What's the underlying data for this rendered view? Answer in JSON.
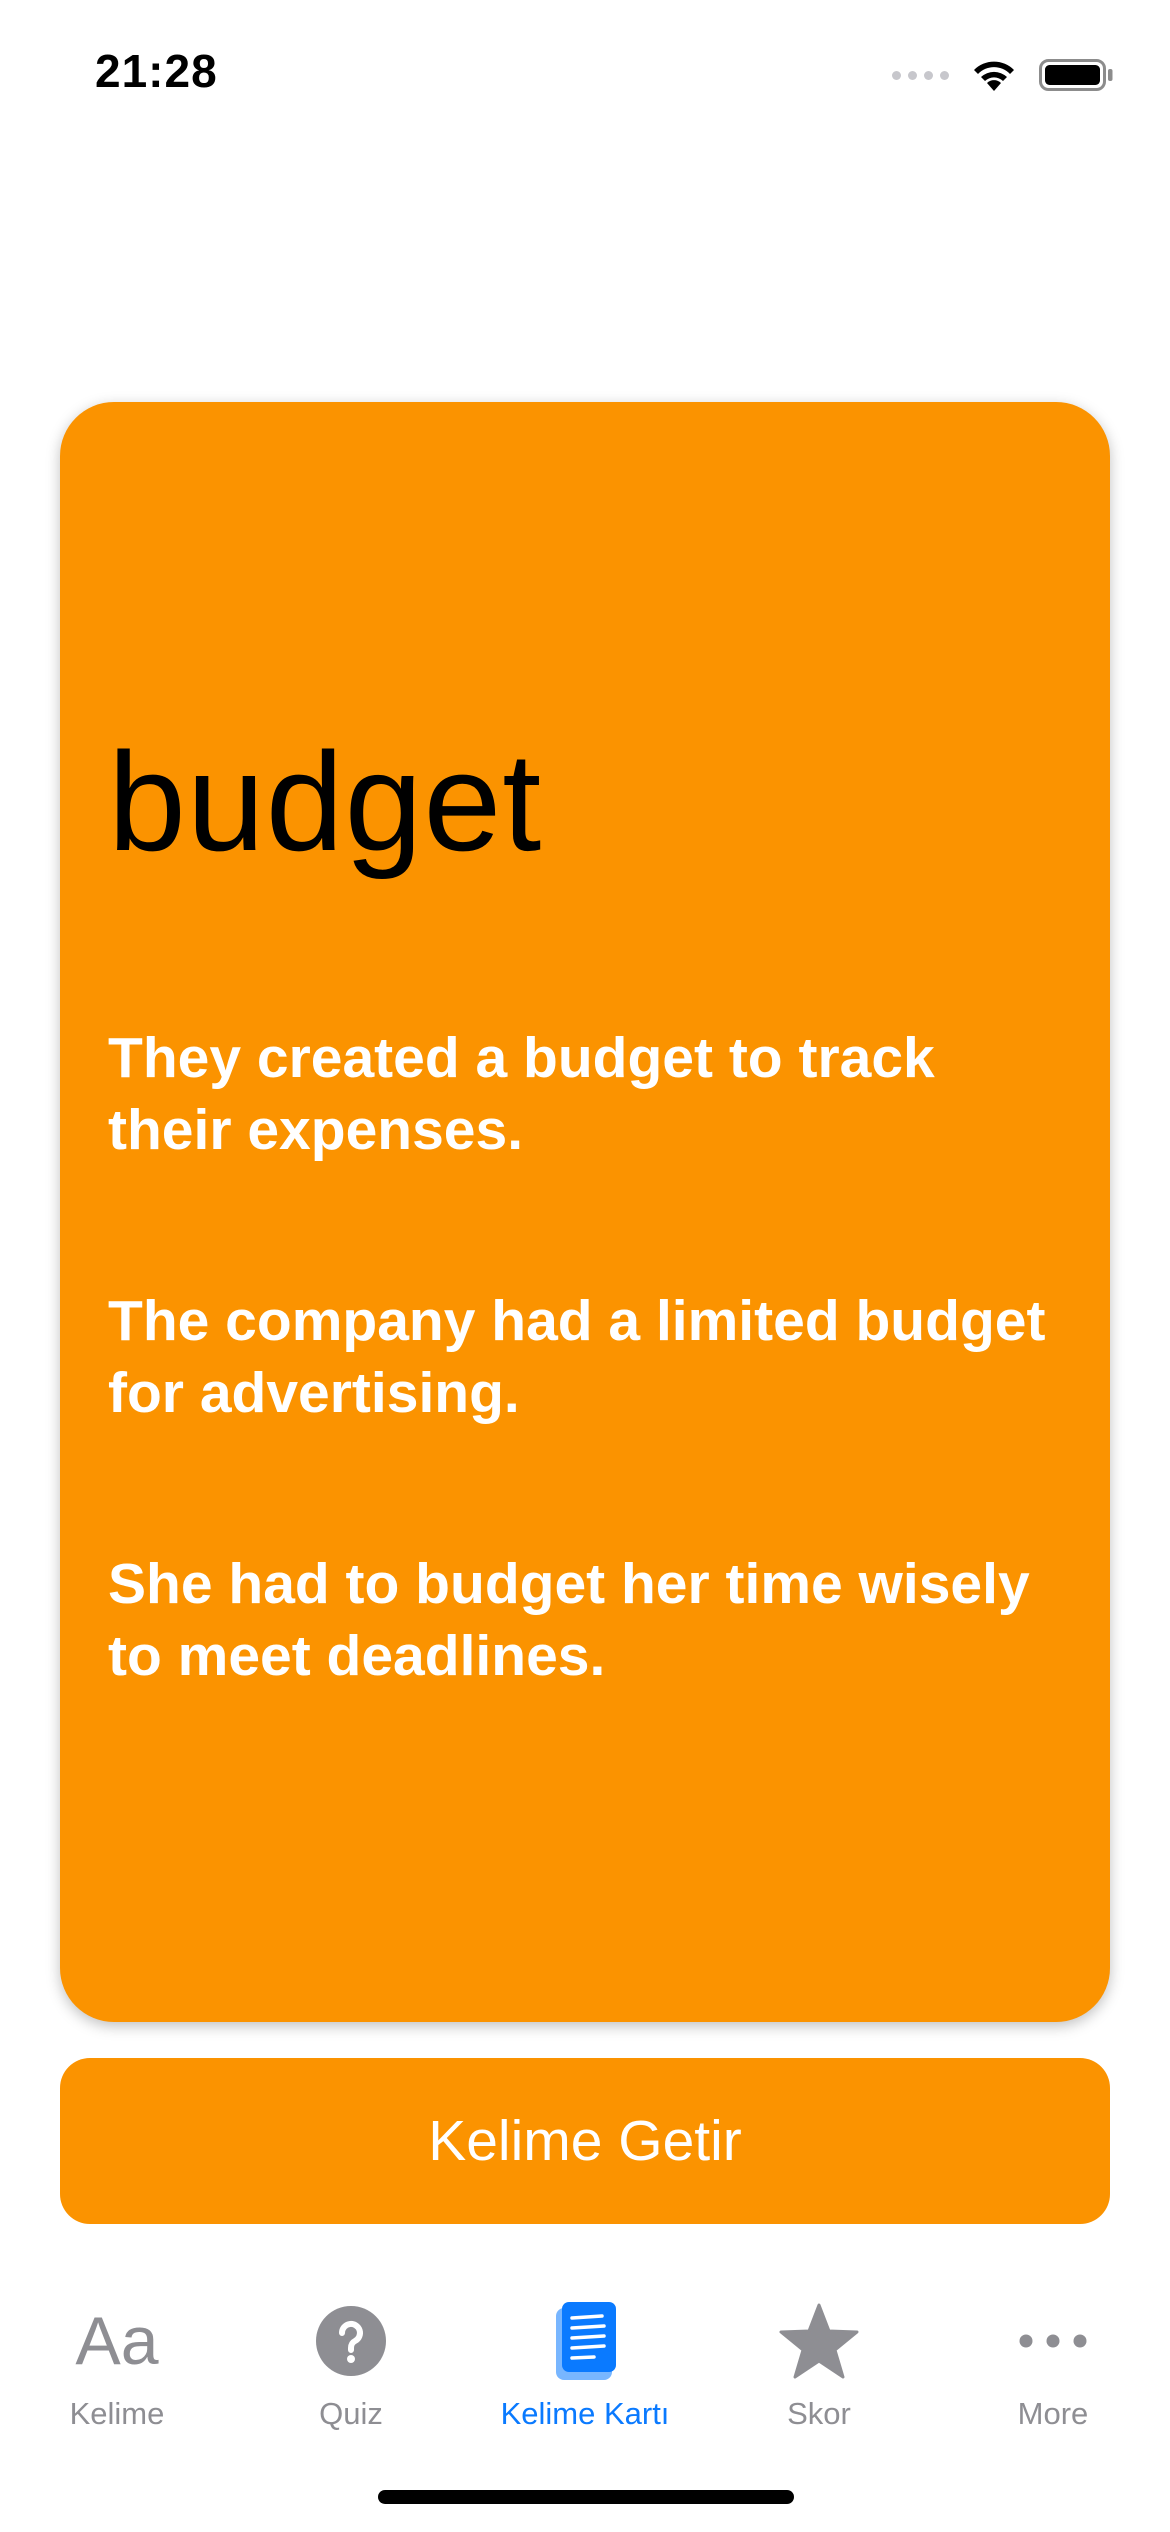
{
  "status_bar": {
    "time": "21:28"
  },
  "card": {
    "word": "budget",
    "examples": [
      "They created a budget to track their expenses.",
      "The company had a limited budget for advertising.",
      "She had to budget her time wisely to meet deadlines."
    ]
  },
  "fetch_button": {
    "label": "Kelime Getir"
  },
  "tab_bar": {
    "tabs": [
      {
        "label": "Kelime",
        "icon": "text-format-icon"
      },
      {
        "label": "Quiz",
        "icon": "question-circle-icon"
      },
      {
        "label": "Kelime Kartı",
        "icon": "book-icon",
        "active": true
      },
      {
        "label": "Skor",
        "icon": "star-icon"
      },
      {
        "label": "More",
        "icon": "ellipsis-icon"
      }
    ],
    "active_color": "#0a7aff",
    "inactive_color": "#8e8e93"
  },
  "colors": {
    "card": "#fb9300",
    "button": "#fb9300"
  }
}
